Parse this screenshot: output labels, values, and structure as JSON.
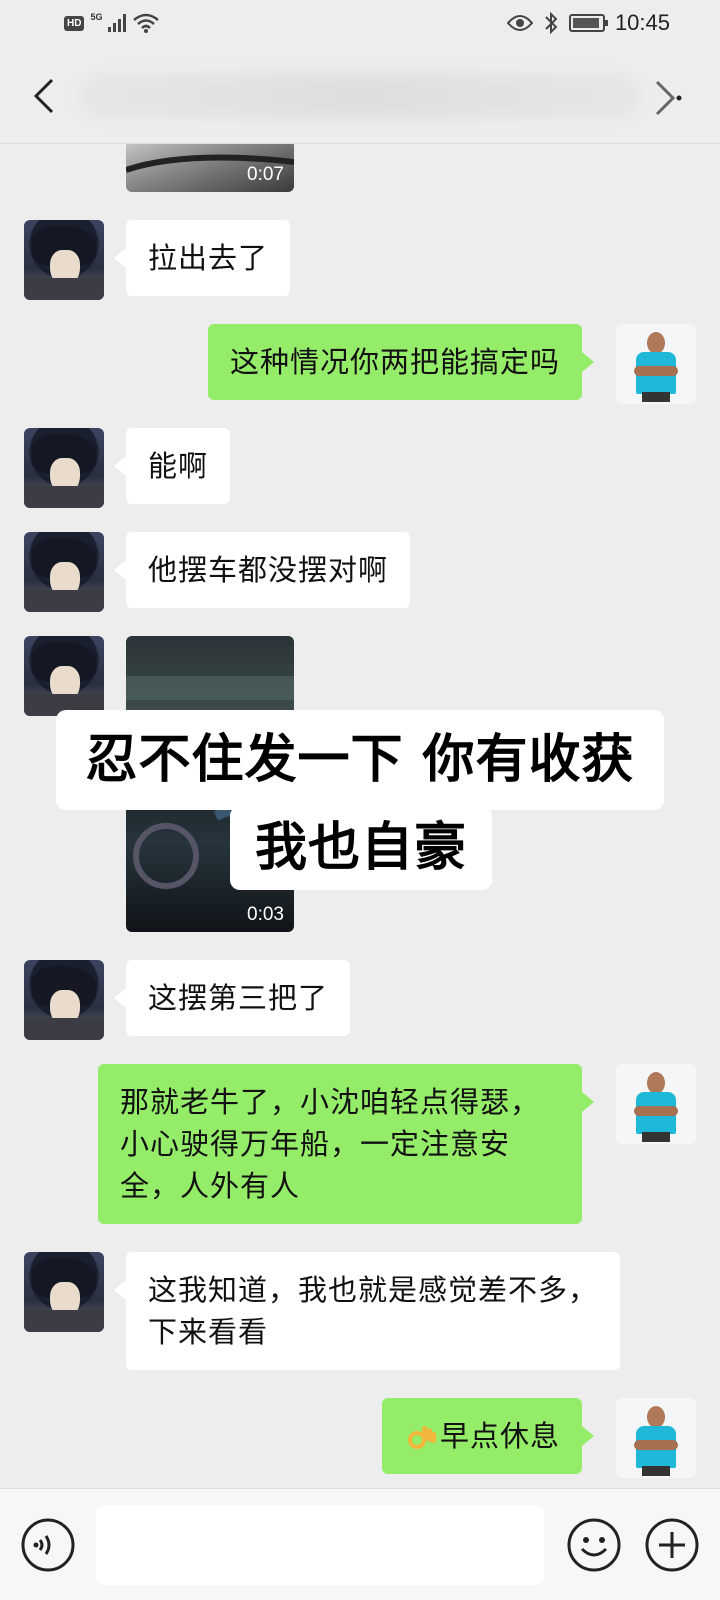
{
  "status_bar": {
    "hd": "HD",
    "network": "5G",
    "time": "10:45"
  },
  "header": {
    "back_icon": "chevron-left-icon",
    "more_icon": "chevron-right-icon"
  },
  "messages": [
    {
      "type": "video",
      "side": "left",
      "duration": "0:07"
    },
    {
      "type": "text",
      "side": "left",
      "text": "拉出去了"
    },
    {
      "type": "text",
      "side": "right",
      "text": "这种情况你两把能搞定吗"
    },
    {
      "type": "text",
      "side": "left",
      "text": "能啊"
    },
    {
      "type": "text",
      "side": "left",
      "text": "他摆车都没摆对啊"
    },
    {
      "type": "video",
      "side": "left",
      "duration": "0:03"
    },
    {
      "type": "text",
      "side": "left",
      "text": "这摆第三把了"
    },
    {
      "type": "text",
      "side": "right",
      "text": "那就老牛了，小沈咱轻点得瑟，小心驶得万年船，一定注意安全，人外有人"
    },
    {
      "type": "text",
      "side": "left",
      "text": "这我知道，我也就是感觉差不多，下来看看"
    },
    {
      "type": "text",
      "side": "right",
      "text": "早点休息",
      "emoji": "ok-hand"
    }
  ],
  "overlay_caption": {
    "line1": "忍不住发一下 你有收获",
    "line2": "我也自豪"
  },
  "input_bar": {
    "voice_icon": "voice-icon",
    "emoji_icon": "emoji-icon",
    "plus_icon": "plus-icon",
    "input_value": ""
  }
}
